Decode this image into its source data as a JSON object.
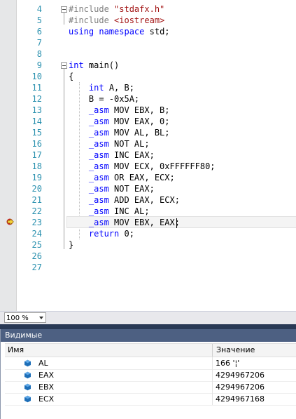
{
  "editor": {
    "lines": [
      {
        "n": "4",
        "html": "<span class=\"pre\">#include </span><span class=\"str\">\"stdafx.h\"</span>"
      },
      {
        "n": "5",
        "html": "<span class=\"pre\">#include </span><span class=\"str\">&lt;iostream&gt;</span>"
      },
      {
        "n": "6",
        "html": "<span class=\"kw\">using</span> <span class=\"kw\">namespace</span> std;"
      },
      {
        "n": "7",
        "html": ""
      },
      {
        "n": "8",
        "html": ""
      },
      {
        "n": "9",
        "html": "<span class=\"kw\">int</span> main()"
      },
      {
        "n": "10",
        "html": "{"
      },
      {
        "n": "11",
        "html": "    <span class=\"kw\">int</span> A, B;"
      },
      {
        "n": "12",
        "html": "    B = -0x5A;"
      },
      {
        "n": "13",
        "html": "    <span class=\"kw\">_asm</span> MOV EBX, B;"
      },
      {
        "n": "14",
        "html": "    <span class=\"kw\">_asm</span> MOV EAX, 0;"
      },
      {
        "n": "15",
        "html": "    <span class=\"kw\">_asm</span> MOV AL, BL;"
      },
      {
        "n": "16",
        "html": "    <span class=\"kw\">_asm</span> NOT AL;"
      },
      {
        "n": "17",
        "html": "    <span class=\"kw\">_asm</span> INC EAX;"
      },
      {
        "n": "18",
        "html": "    <span class=\"kw\">_asm</span> MOV ECX, 0xFFFFFF80;"
      },
      {
        "n": "19",
        "html": "    <span class=\"kw\">_asm</span> OR EAX, ECX;"
      },
      {
        "n": "20",
        "html": "    <span class=\"kw\">_asm</span> NOT EAX;"
      },
      {
        "n": "21",
        "html": "    <span class=\"kw\">_asm</span> ADD EAX, ECX;"
      },
      {
        "n": "22",
        "html": "    <span class=\"kw\">_asm</span> INC AL;"
      },
      {
        "n": "23",
        "html": "    <span class=\"kw\">_asm</span> MOV EBX, EAX;"
      },
      {
        "n": "24",
        "html": "    <span class=\"kw\">return</span> 0;"
      },
      {
        "n": "25",
        "html": "}"
      },
      {
        "n": "26",
        "html": ""
      },
      {
        "n": "27",
        "html": ""
      }
    ],
    "current_line": "23",
    "fold_lines": [
      "4",
      "9"
    ]
  },
  "zoom": {
    "value": "100 %"
  },
  "watch": {
    "title": "Видимые",
    "col_name": "Имя",
    "col_value": "Значение",
    "rows": [
      {
        "name": "AL",
        "value": "166 '¦'"
      },
      {
        "name": "EAX",
        "value": "4294967206"
      },
      {
        "name": "EBX",
        "value": "4294967206"
      },
      {
        "name": "ECX",
        "value": "4294967168"
      }
    ]
  },
  "colors": {
    "accent": "#4d6082",
    "line_number": "#2b91af",
    "keyword": "#0000ff",
    "string": "#a31515"
  }
}
